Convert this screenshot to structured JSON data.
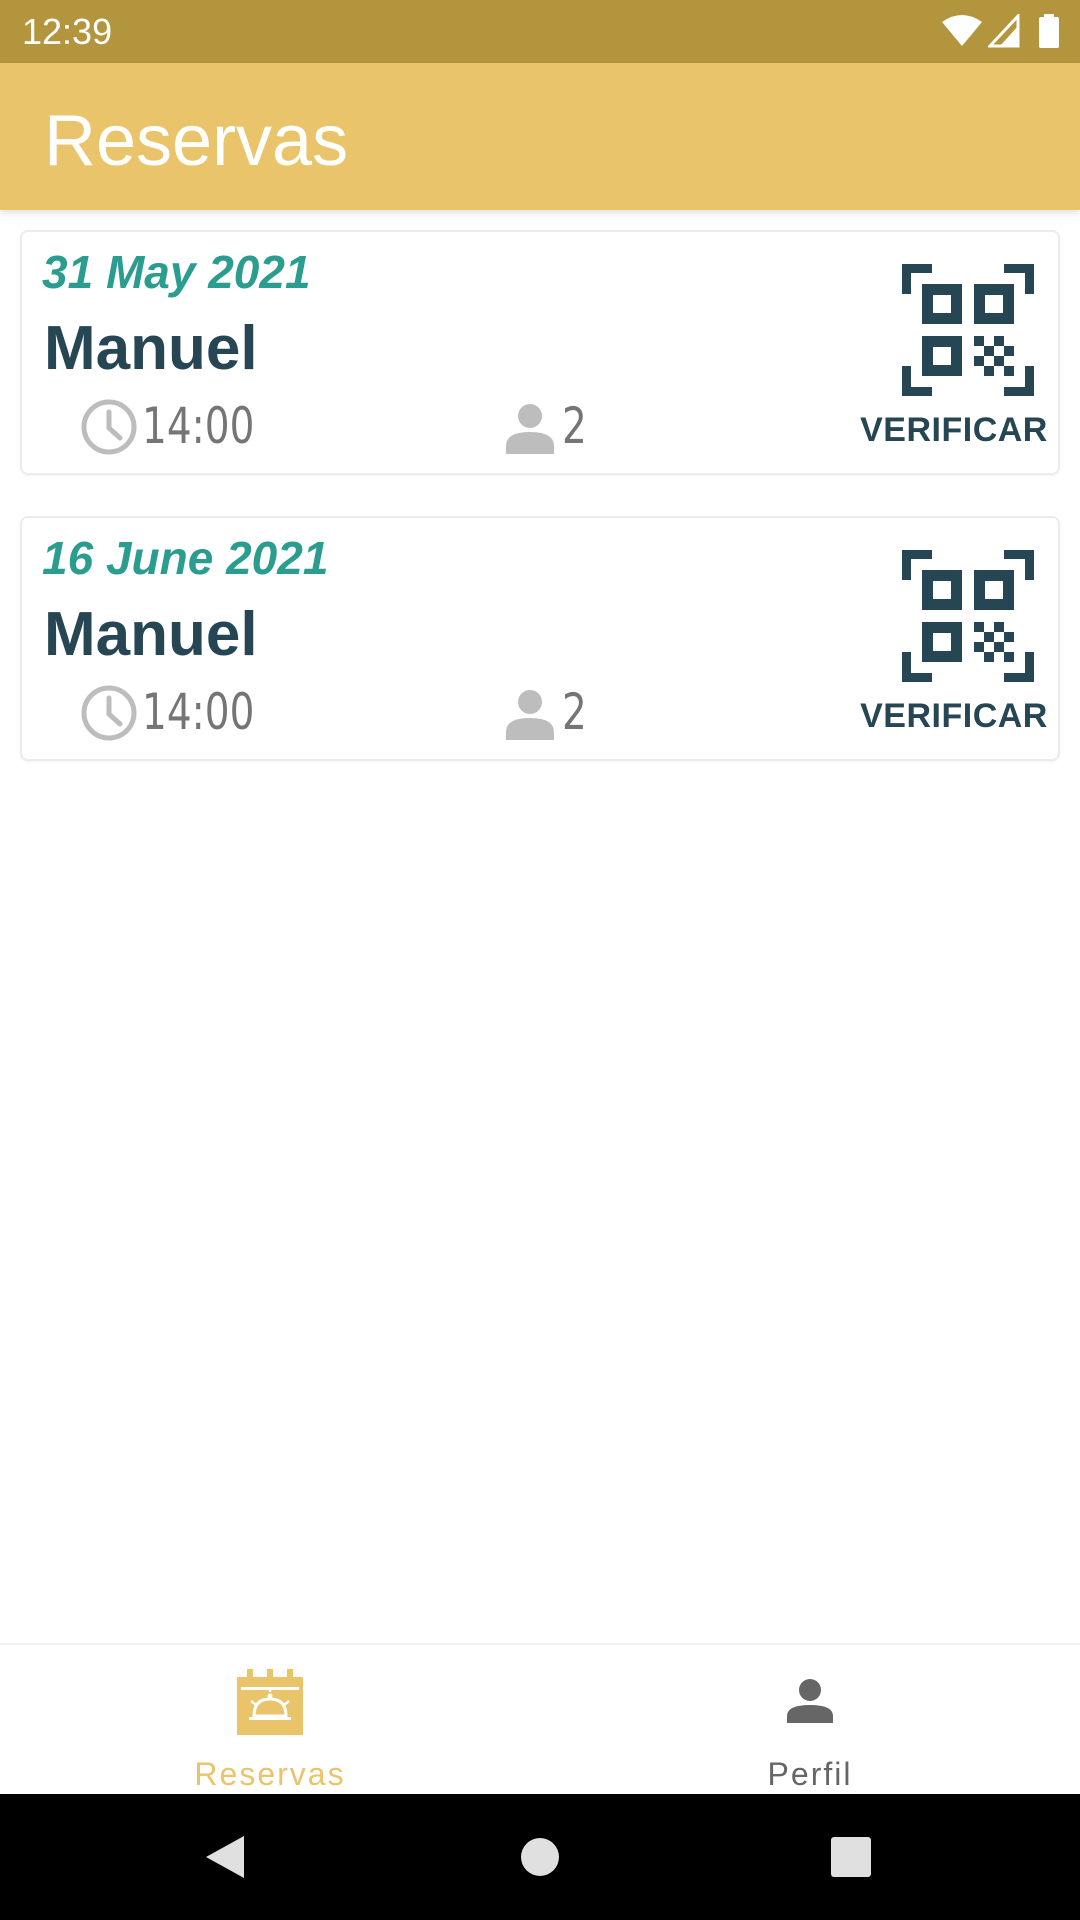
{
  "status_bar": {
    "time": "12:39",
    "icons": [
      "wifi-icon",
      "signal-icon",
      "battery-icon"
    ]
  },
  "app_bar": {
    "title": "Reservas"
  },
  "reservations": [
    {
      "date": "31 May 2021",
      "name": "Manuel",
      "time": "14:00",
      "guests": "2",
      "verify_label": "VERIFICAR"
    },
    {
      "date": "16 June 2021",
      "name": "Manuel",
      "time": "14:00",
      "guests": "2",
      "verify_label": "VERIFICAR"
    }
  ],
  "bottom_nav": {
    "items": [
      {
        "label": "Reservas",
        "icon": "calendar-dish-icon",
        "active": true
      },
      {
        "label": "Perfil",
        "icon": "person-icon",
        "active": false
      }
    ]
  },
  "colors": {
    "status_bar": "#b3953e",
    "app_bar": "#e9c46a",
    "date_teal": "#2a9d8f",
    "dark_slate": "#264653",
    "meta_grey": "#757575",
    "icon_grey": "#bdbdbd"
  }
}
